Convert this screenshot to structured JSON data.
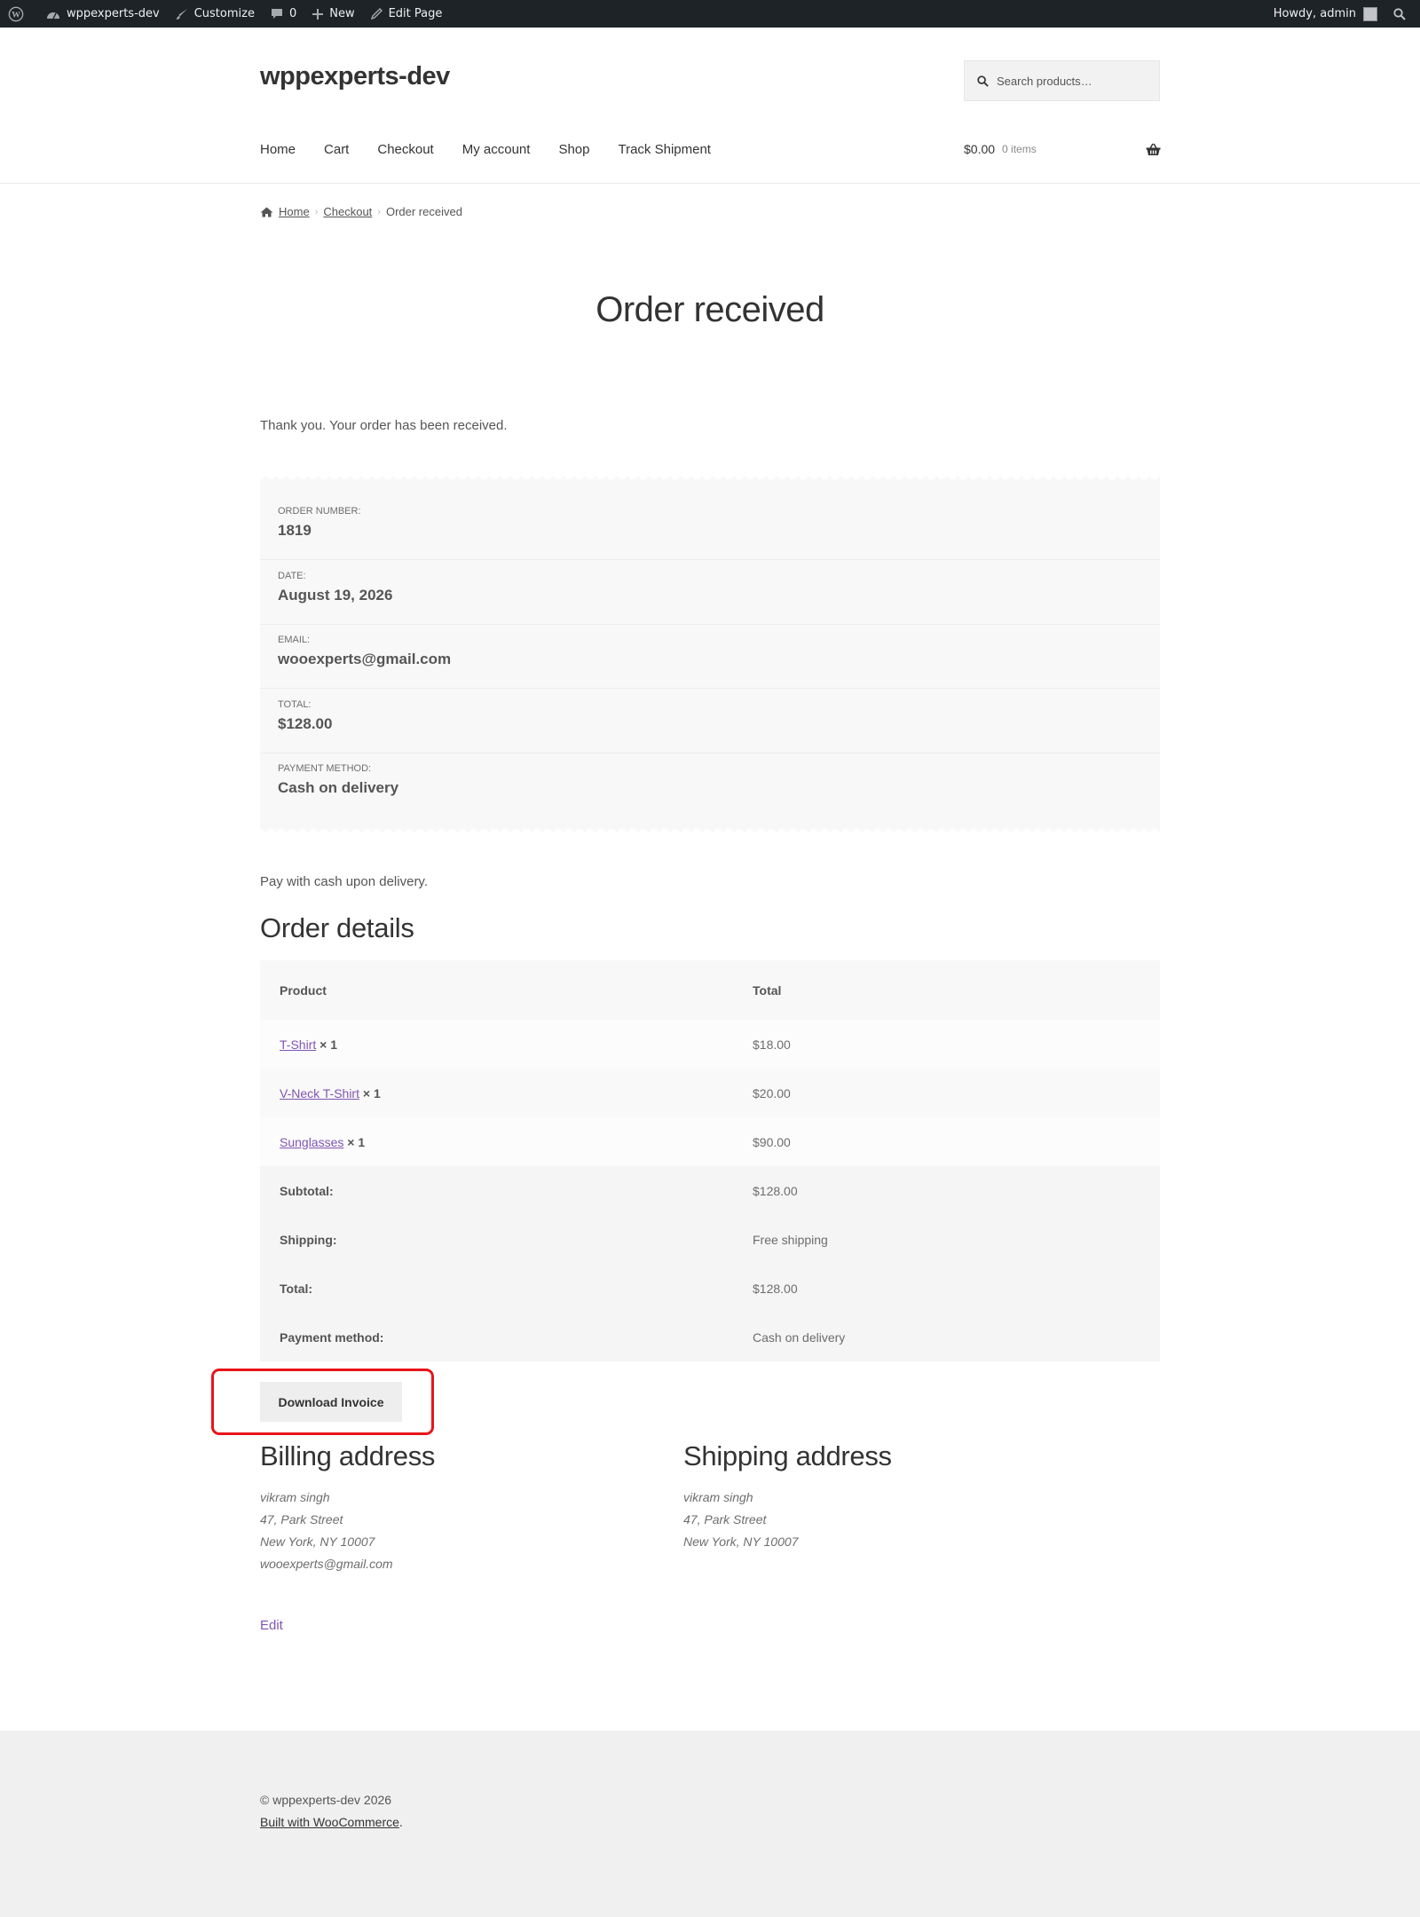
{
  "adminbar": {
    "site_name": "wppexperts-dev",
    "customize": "Customize",
    "comments_count": "0",
    "new": "New",
    "edit_page": "Edit Page",
    "howdy": "Howdy, admin"
  },
  "header": {
    "site_title": "wppexperts-dev",
    "search_placeholder": "Search products…",
    "nav": [
      "Home",
      "Cart",
      "Checkout",
      "My account",
      "Shop",
      "Track Shipment"
    ],
    "cart_total": "$0.00",
    "cart_items": "0 items"
  },
  "breadcrumb": {
    "home": "Home",
    "checkout": "Checkout",
    "current": "Order received"
  },
  "page": {
    "title": "Order received",
    "thank_you": "Thank you. Your order has been received."
  },
  "overview": {
    "order_number_label": "Order number:",
    "order_number": "1819",
    "date_label": "Date:",
    "date": "August 19, 2026",
    "email_label": "Email:",
    "email": "wooexperts@gmail.com",
    "total_label": "Total:",
    "total": "$128.00",
    "payment_label": "Payment method:",
    "payment": "Cash on delivery"
  },
  "pay_note": "Pay with cash upon delivery.",
  "order_details": {
    "heading": "Order details",
    "col_product": "Product",
    "col_total": "Total",
    "items": [
      {
        "name": "T-Shirt",
        "qty": "× 1",
        "total": "$18.00"
      },
      {
        "name": "V-Neck T-Shirt",
        "qty": "× 1",
        "total": "$20.00"
      },
      {
        "name": "Sunglasses",
        "qty": "× 1",
        "total": "$90.00"
      }
    ],
    "totals": [
      {
        "label": "Subtotal:",
        "value": "$128.00"
      },
      {
        "label": "Shipping:",
        "value": "Free shipping"
      },
      {
        "label": "Total:",
        "value": "$128.00"
      },
      {
        "label": "Payment method:",
        "value": "Cash on delivery"
      }
    ]
  },
  "download_invoice": "Download Invoice",
  "billing": {
    "heading": "Billing address",
    "lines": [
      "vikram singh",
      "47, Park Street",
      "New York, NY 10007",
      "wooexperts@gmail.com"
    ]
  },
  "shipping": {
    "heading": "Shipping address",
    "lines": [
      "vikram singh",
      "47, Park Street",
      "New York, NY 10007"
    ]
  },
  "edit": "Edit",
  "footer": {
    "copyright": "© wppexperts-dev 2026",
    "built_with": "Built with WooCommerce",
    "built_suffix": "."
  },
  "colors": {
    "admin_bar": "#1d2327",
    "link_purple": "#7f54b3",
    "highlight_red": "#e8141b",
    "panel_bg": "#f8f8f8",
    "footer_bg": "#f0f0f0"
  }
}
